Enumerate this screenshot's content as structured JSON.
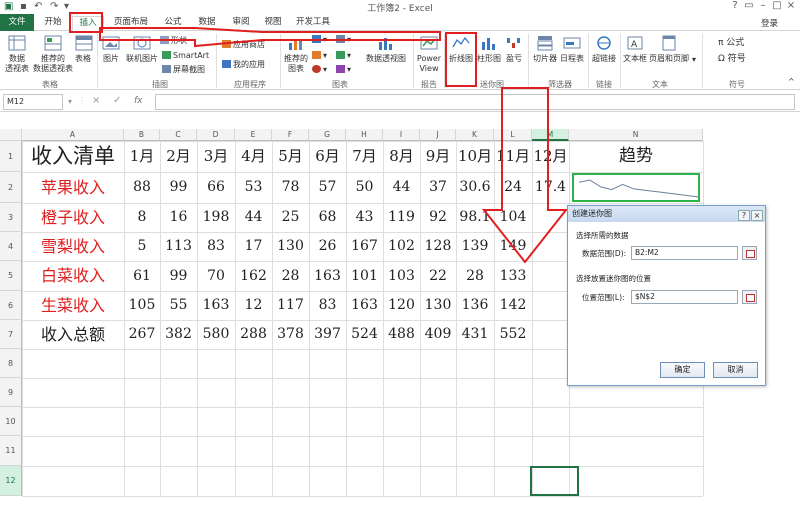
{
  "window": {
    "title": "工作簿2 - Excel",
    "help_label": "?",
    "login_label": "登录"
  },
  "tabs": [
    {
      "label": "文件"
    },
    {
      "label": "开始"
    },
    {
      "label": "插入"
    },
    {
      "label": "页面布局"
    },
    {
      "label": "公式"
    },
    {
      "label": "数据"
    },
    {
      "label": "审阅"
    },
    {
      "label": "视图"
    },
    {
      "label": "开发工具"
    }
  ],
  "ribbon": {
    "pivottable": "数据\n透视表",
    "recommended_pivot": "推荐的\n数据透视表",
    "table": "表格",
    "pictures": "图片",
    "online_pictures": "联机图片",
    "shapes": "形状",
    "smartart": "SmartArt",
    "screenshot": "屏幕截图",
    "store": "应用商店",
    "my_apps": "我的应用",
    "recommended_charts": "推荐的\n图表",
    "pivotchart": "数据透视图",
    "power_view": "Power\nView",
    "line_sparkline": "折线图",
    "column_sparkline": "柱形图",
    "winloss": "盈亏",
    "slicer": "切片器",
    "timeline": "日程表",
    "hyperlink": "超链接",
    "textbox": "文本框",
    "header_footer": "页眉和页脚",
    "formula": "π 公式",
    "symbol": "Ω 符号",
    "groups": {
      "tables": "表格",
      "illustrations": "插图",
      "apps": "应用程序",
      "charts": "图表",
      "reports": "报告",
      "sparklines": "迷你图",
      "filters": "筛选器",
      "links": "链接",
      "text": "文本",
      "symbols": "符号"
    }
  },
  "formula_bar": {
    "name_box": "M12",
    "fx": "fx",
    "cancel_icon": "×",
    "enter_icon": "✓"
  },
  "sheet": {
    "columns": [
      "A",
      "B",
      "C",
      "D",
      "E",
      "F",
      "G",
      "H",
      "I",
      "J",
      "K",
      "L",
      "M",
      "N"
    ],
    "rows": [
      "1",
      "2",
      "3",
      "4",
      "5",
      "6",
      "7",
      "8",
      "9",
      "10",
      "11",
      "12"
    ],
    "header_row": [
      "收入清单",
      "1月",
      "2月",
      "3月",
      "4月",
      "5月",
      "6月",
      "7月",
      "8月",
      "9月",
      "10月",
      "11月",
      "12月",
      "趋势"
    ],
    "data_rows": [
      {
        "label": "苹果收入",
        "values": [
          "88",
          "99",
          "66",
          "53",
          "78",
          "57",
          "50",
          "44",
          "37",
          "30.6",
          "24",
          "17.4"
        ]
      },
      {
        "label": "橙子收入",
        "values": [
          "8",
          "16",
          "198",
          "44",
          "25",
          "68",
          "43",
          "119",
          "92",
          "98.1",
          "104",
          ""
        ]
      },
      {
        "label": "雪梨收入",
        "values": [
          "5",
          "113",
          "83",
          "17",
          "130",
          "26",
          "167",
          "102",
          "128",
          "139",
          "149",
          ""
        ]
      },
      {
        "label": "白菜收入",
        "values": [
          "61",
          "99",
          "70",
          "162",
          "28",
          "163",
          "101",
          "103",
          "22",
          "28",
          "133",
          ""
        ]
      },
      {
        "label": "生菜收入",
        "values": [
          "105",
          "55",
          "163",
          "12",
          "117",
          "83",
          "163",
          "120",
          "130",
          "136",
          "142",
          ""
        ]
      }
    ],
    "total_row": {
      "label": "收入总额",
      "values": [
        "267",
        "382",
        "580",
        "288",
        "378",
        "397",
        "524",
        "488",
        "409",
        "431",
        "552",
        ""
      ]
    },
    "label_color": "#e02020",
    "sparkline_color": "#6b7f9e",
    "sparkline_box_color": "#2db34a"
  },
  "dialog": {
    "title": "创建迷你图",
    "section_data": "选择所需的数据",
    "data_range_label": "数据范围(D):",
    "data_range_value": "B2:M2",
    "section_location": "选择放置迷你图的位置",
    "location_label": "位置范围(L):",
    "location_value": "$N$2",
    "ok": "确定",
    "cancel": "取消",
    "help": "?",
    "close": "×"
  },
  "annotation_color": "#e02020"
}
